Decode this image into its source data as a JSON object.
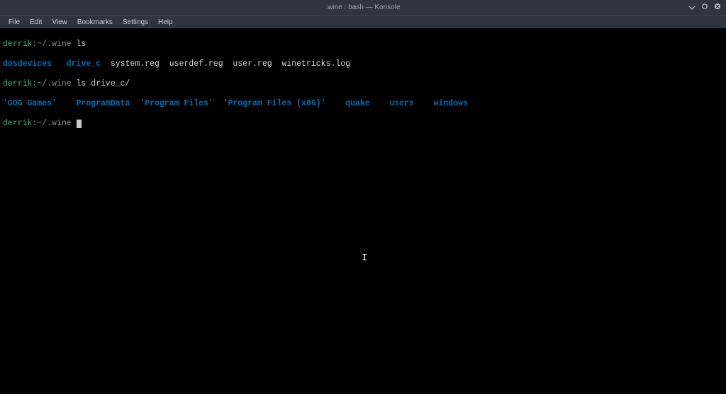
{
  "window": {
    "title": ".wine : bash — Konsole"
  },
  "menu": {
    "file": "File",
    "edit": "Edit",
    "view": "View",
    "bookmarks": "Bookmarks",
    "settings": "Settings",
    "help": "Help"
  },
  "term": {
    "line1": {
      "user": "derrik:",
      "path": "~/.wine",
      "cmd": " ls"
    },
    "line2": {
      "d1": "dosdevices",
      "s1": "   ",
      "d2": "drive_c",
      "s2": "  ",
      "f1": "system.reg",
      "s3": "  ",
      "f2": "userdef.reg",
      "s4": "  ",
      "f3": "user.reg",
      "s5": "  ",
      "f4": "winetricks.log"
    },
    "line3": {
      "user": "derrik:",
      "path": "~/.wine",
      "cmd": " ls drive_c/"
    },
    "line4": {
      "d1": "'GOG Games'",
      "s1": "   ",
      "d2": " ProgramData",
      "s2": "  ",
      "d3": "'Program Files'",
      "s3": "  ",
      "d4": "'Program Files (x86)'",
      "s4": "   ",
      "d5": " quake",
      "s5": "   ",
      "d6": " users",
      "s6": "   ",
      "d7": " windows"
    },
    "line5": {
      "user": "derrik:",
      "path": "~/.wine",
      "cmd": " "
    }
  },
  "caret": "I"
}
